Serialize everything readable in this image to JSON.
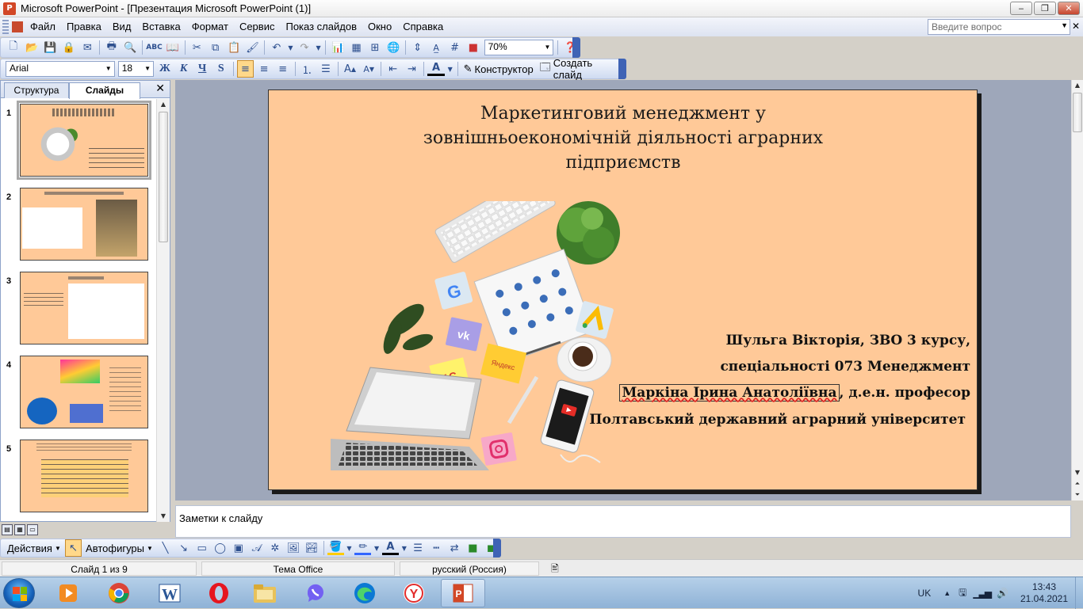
{
  "window": {
    "title": "Microsoft PowerPoint - [Презентация Microsoft PowerPoint (1)]",
    "ask_placeholder": "Введите вопрос"
  },
  "menu": [
    "Файл",
    "Правка",
    "Вид",
    "Вставка",
    "Формат",
    "Сервис",
    "Показ слайдов",
    "Окно",
    "Справка"
  ],
  "toolbar": {
    "zoom": "70%",
    "font_name": "Arial",
    "font_size": "18",
    "bold": "Ж",
    "italic": "К",
    "underline": "Ч",
    "shadow": "S",
    "designer": "Конструктор",
    "new_slide": "Создать слайд"
  },
  "leftpane": {
    "tab_outline": "Структура",
    "tab_slides": "Слайды",
    "slide_numbers": [
      "1",
      "2",
      "3",
      "4",
      "5"
    ]
  },
  "slide": {
    "title_line1": "Маркетинговий  менеджмент у",
    "title_line2": "зовнішньоекономічній  діяльності аграрних",
    "title_line3": "підприємств",
    "author_line1": "Шульга Вікторія, ЗВО 3 курсу,",
    "author_line2": "спеціальності 073 Менеджмент",
    "supervisor_name": "Маркіна Ірина Анатоліївна",
    "supervisor_title": ", д.е.н. професор",
    "university": "Полтавський державний аграрний університет"
  },
  "notes_placeholder": "Заметки к слайду",
  "drawbar": {
    "actions": "Действия",
    "autoshapes": "Автофигуры"
  },
  "status": {
    "slide_counter": "Слайд 1 из 9",
    "theme": "Тема Office",
    "language": "русский (Россия)"
  },
  "taskbar": {
    "lang": "UK",
    "time": "13:43",
    "date": "21.04.2021"
  },
  "colors": {
    "slide_bg": "#ffc998",
    "edit_bg": "#9ea7ba",
    "toolbar_accent": "#3f63b5"
  }
}
